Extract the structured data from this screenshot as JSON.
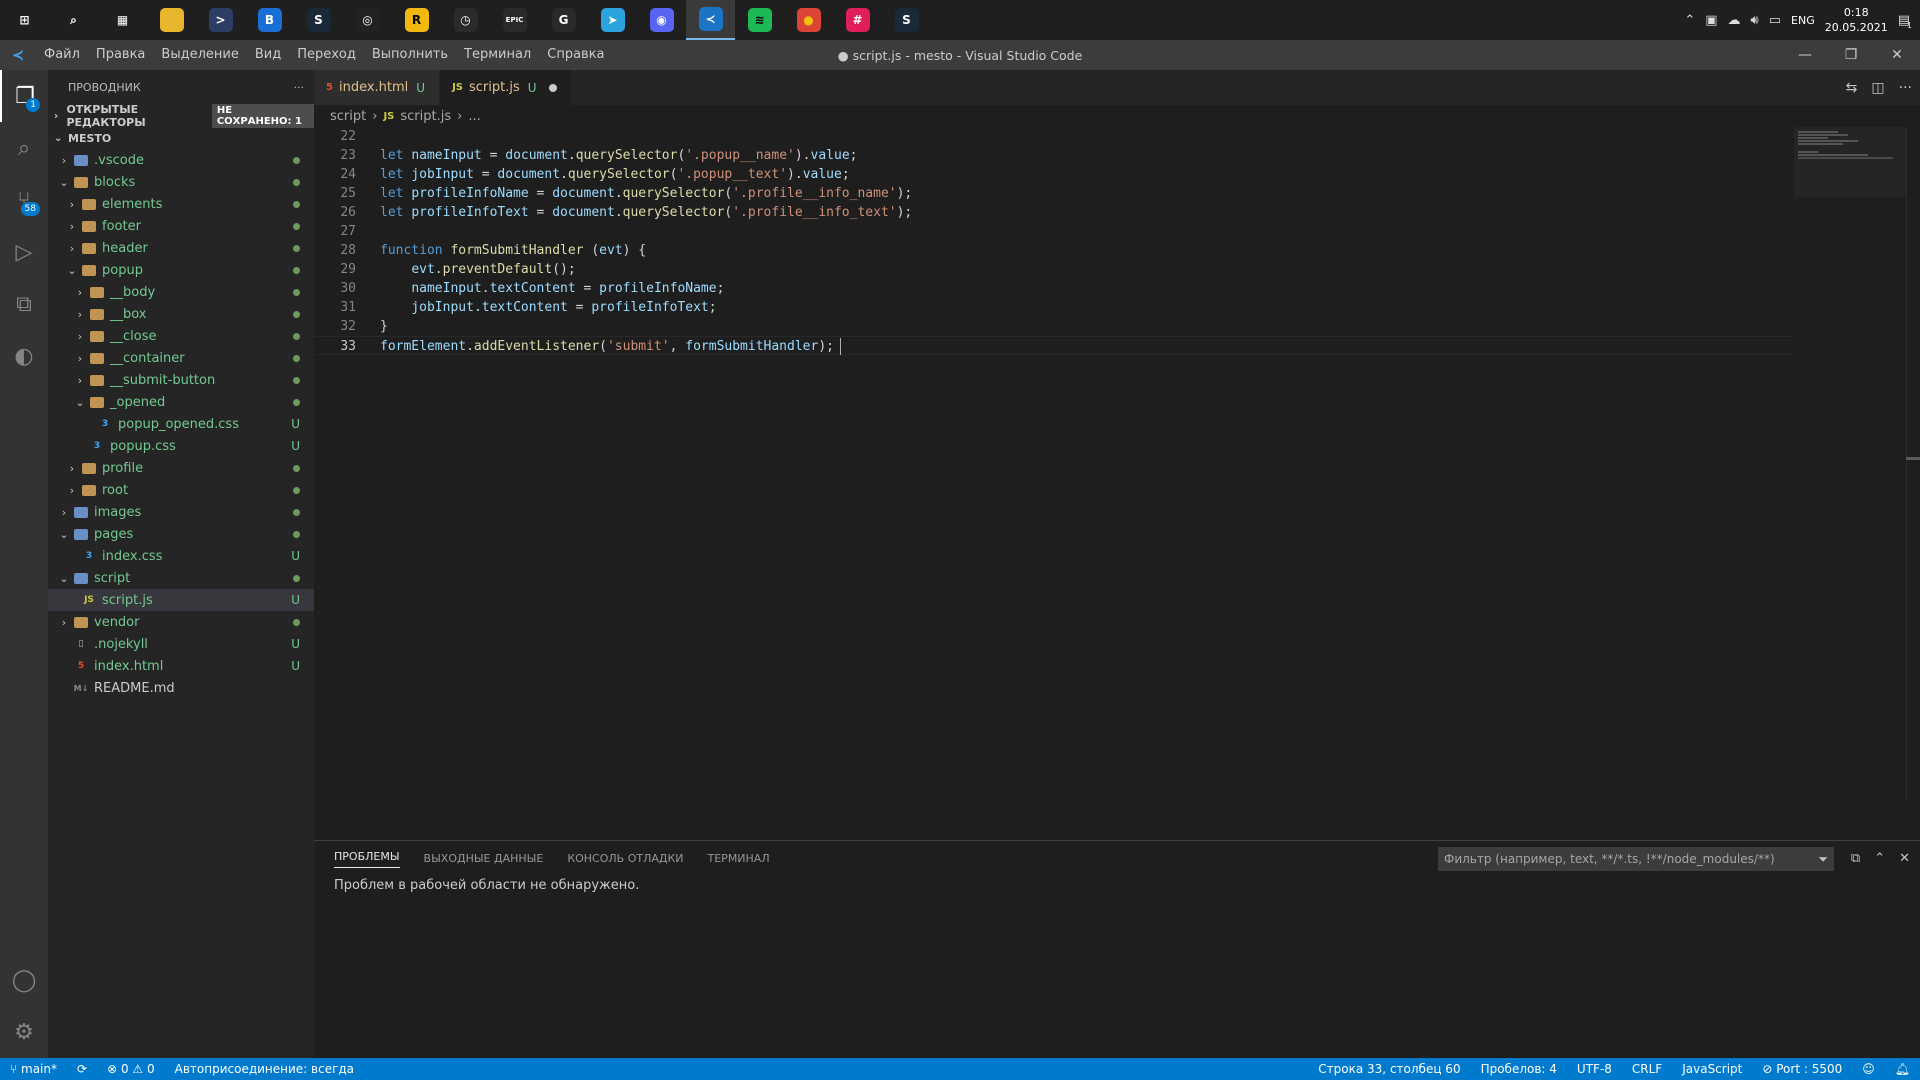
{
  "taskbar": {
    "apps": [
      {
        "name": "windows-start-icon",
        "glyph": "⊞",
        "color": "#1f1f1f",
        "fg": "#ffffff"
      },
      {
        "name": "search-icon",
        "glyph": "⌕",
        "color": "#1f1f1f",
        "fg": "#ffffff"
      },
      {
        "name": "task-view-icon",
        "glyph": "▦",
        "color": "#1f1f1f",
        "fg": "#ffffff"
      },
      {
        "name": "file-explorer-icon",
        "glyph": "",
        "color": "#e8b52c",
        "fg": "#ffffff"
      },
      {
        "name": "terminal-icon",
        "glyph": ">",
        "color": "#2c3e66",
        "fg": "#ffffff"
      },
      {
        "name": "app-blue-icon",
        "glyph": "B",
        "color": "#1a6fd6",
        "fg": "#ffffff"
      },
      {
        "name": "steam-icon",
        "glyph": "S",
        "color": "#1b2838",
        "fg": "#ffffff"
      },
      {
        "name": "obs-icon",
        "glyph": "◎",
        "color": "#222222",
        "fg": "#ffffff"
      },
      {
        "name": "rockstar-icon",
        "glyph": "R",
        "color": "#f2b80d",
        "fg": "#000000"
      },
      {
        "name": "clock-app-icon",
        "glyph": "◷",
        "color": "#2a2a2a",
        "fg": "#ffffff"
      },
      {
        "name": "epic-games-icon",
        "glyph": "EPIC",
        "color": "#2a2a2a",
        "fg": "#ffffff"
      },
      {
        "name": "g-hub-icon",
        "glyph": "G",
        "color": "#2a2a2a",
        "fg": "#ffffff"
      },
      {
        "name": "telegram-icon",
        "glyph": "➤",
        "color": "#2aa3de",
        "fg": "#ffffff"
      },
      {
        "name": "discord-icon",
        "glyph": "◉",
        "color": "#5865f2",
        "fg": "#ffffff"
      },
      {
        "name": "vscode-icon",
        "glyph": "≺",
        "color": "#1b74c5",
        "fg": "#ffffff",
        "active": true
      },
      {
        "name": "spotify-icon",
        "glyph": "≋",
        "color": "#1db954",
        "fg": "#000000"
      },
      {
        "name": "chrome-icon",
        "glyph": "●",
        "color": "#db4437",
        "fg": "#f4c20d"
      },
      {
        "name": "slack-icon",
        "glyph": "#",
        "color": "#e01e5a",
        "fg": "#ffffff"
      },
      {
        "name": "steam-icon-2",
        "glyph": "S",
        "color": "#1b2838",
        "fg": "#ffffff"
      }
    ],
    "tray": {
      "lang": "ENG",
      "time": "0:18",
      "date": "20.05.2021",
      "notifications": "1"
    }
  },
  "titlebar": {
    "menu": [
      "Файл",
      "Правка",
      "Выделение",
      "Вид",
      "Переход",
      "Выполнить",
      "Терминал",
      "Справка"
    ],
    "title": "● script.js - mesto - Visual Studio Code"
  },
  "activitybar": {
    "explorer_badge": "1",
    "scm_badge": "58"
  },
  "sidebar": {
    "title": "ПРОВОДНИК",
    "more": "···",
    "open_editors": "ОТКРЫТЫЕ РЕДАКТОРЫ",
    "unsaved": "НЕ СОХРАНЕНО: 1",
    "project": "MESTO",
    "tree": [
      {
        "label": ".vscode",
        "depth": 0,
        "type": "folder",
        "special": true,
        "chev": "›",
        "status": "dot"
      },
      {
        "label": "blocks",
        "depth": 0,
        "type": "folder",
        "chev": "⌄",
        "status": "dot"
      },
      {
        "label": "elements",
        "depth": 1,
        "type": "folder",
        "chev": "›",
        "status": "dot"
      },
      {
        "label": "footer",
        "depth": 1,
        "type": "folder",
        "chev": "›",
        "status": "dot"
      },
      {
        "label": "header",
        "depth": 1,
        "type": "folder",
        "chev": "›",
        "status": "dot"
      },
      {
        "label": "popup",
        "depth": 1,
        "type": "folder",
        "chev": "⌄",
        "status": "dot"
      },
      {
        "label": "__body",
        "depth": 2,
        "type": "folder",
        "chev": "›",
        "status": "dot"
      },
      {
        "label": "__box",
        "depth": 2,
        "type": "folder",
        "chev": "›",
        "status": "dot"
      },
      {
        "label": "__close",
        "depth": 2,
        "type": "folder",
        "chev": "›",
        "status": "dot"
      },
      {
        "label": "__container",
        "depth": 2,
        "type": "folder",
        "chev": "›",
        "status": "dot"
      },
      {
        "label": "__submit-button",
        "depth": 2,
        "type": "folder",
        "chev": "›",
        "status": "dot"
      },
      {
        "label": "_opened",
        "depth": 2,
        "type": "folder",
        "chev": "⌄",
        "status": "dot"
      },
      {
        "label": "popup_opened.css",
        "depth": 3,
        "type": "css",
        "status": "U"
      },
      {
        "label": "popup.css",
        "depth": 2,
        "type": "css",
        "status": "U"
      },
      {
        "label": "profile",
        "depth": 1,
        "type": "folder",
        "chev": "›",
        "status": "dot"
      },
      {
        "label": "root",
        "depth": 1,
        "type": "folder",
        "chev": "›",
        "status": "dot"
      },
      {
        "label": "images",
        "depth": 0,
        "type": "folder",
        "special": true,
        "chev": "›",
        "status": "dot"
      },
      {
        "label": "pages",
        "depth": 0,
        "type": "folder",
        "special": true,
        "chev": "⌄",
        "status": "dot"
      },
      {
        "label": "index.css",
        "depth": 1,
        "type": "css",
        "status": "U"
      },
      {
        "label": "script",
        "depth": 0,
        "type": "folder",
        "special": true,
        "chev": "⌄",
        "status": "dot"
      },
      {
        "label": "script.js",
        "depth": 1,
        "type": "js",
        "status": "U",
        "selected": true
      },
      {
        "label": "vendor",
        "depth": 0,
        "type": "folder",
        "chev": "›",
        "status": "dot"
      },
      {
        "label": ".nojekyll",
        "depth": 0,
        "type": "file",
        "status": "U"
      },
      {
        "label": "index.html",
        "depth": 0,
        "type": "html",
        "status": "U"
      },
      {
        "label": "README.md",
        "depth": 0,
        "type": "md",
        "status": ""
      }
    ]
  },
  "editor": {
    "tabs": [
      {
        "icon": "5",
        "icon_color": "#e44d26",
        "label": "index.html",
        "status": "U",
        "active": false
      },
      {
        "icon": "JS",
        "icon_color": "#cbcb41",
        "label": "script.js",
        "status": "U",
        "active": true,
        "dirty": true
      }
    ],
    "breadcrumbs": {
      "folder": "script",
      "file_icon": "JS",
      "file": "script.js",
      "tail": "..."
    },
    "lines": [
      {
        "n": "22",
        "tokens": []
      },
      {
        "n": "23",
        "tokens": [
          [
            "kw",
            "let "
          ],
          [
            "var",
            "nameInput"
          ],
          [
            "plain",
            " = "
          ],
          [
            "var",
            "document"
          ],
          [
            "plain",
            "."
          ],
          [
            "fn",
            "querySelector"
          ],
          [
            "plain",
            "("
          ],
          [
            "str",
            "'.popup__name'"
          ],
          [
            "plain",
            ")."
          ],
          [
            "var",
            "value"
          ],
          [
            "plain",
            ";"
          ]
        ]
      },
      {
        "n": "24",
        "tokens": [
          [
            "kw",
            "let "
          ],
          [
            "var",
            "jobInput"
          ],
          [
            "plain",
            " = "
          ],
          [
            "var",
            "document"
          ],
          [
            "plain",
            "."
          ],
          [
            "fn",
            "querySelector"
          ],
          [
            "plain",
            "("
          ],
          [
            "str",
            "'.popup__text'"
          ],
          [
            "plain",
            ")."
          ],
          [
            "var",
            "value"
          ],
          [
            "plain",
            ";"
          ]
        ]
      },
      {
        "n": "25",
        "tokens": [
          [
            "kw",
            "let "
          ],
          [
            "var",
            "profileInfoName"
          ],
          [
            "plain",
            " = "
          ],
          [
            "var",
            "document"
          ],
          [
            "plain",
            "."
          ],
          [
            "fn",
            "querySelector"
          ],
          [
            "plain",
            "("
          ],
          [
            "str",
            "'.profile__info_name'"
          ],
          [
            "plain",
            ");"
          ]
        ]
      },
      {
        "n": "26",
        "tokens": [
          [
            "kw",
            "let "
          ],
          [
            "var",
            "profileInfoText"
          ],
          [
            "plain",
            " = "
          ],
          [
            "var",
            "document"
          ],
          [
            "plain",
            "."
          ],
          [
            "fn",
            "querySelector"
          ],
          [
            "plain",
            "("
          ],
          [
            "str",
            "'.profile__info_text'"
          ],
          [
            "plain",
            ");"
          ]
        ]
      },
      {
        "n": "27",
        "tokens": []
      },
      {
        "n": "28",
        "tokens": [
          [
            "kw",
            "function "
          ],
          [
            "fn",
            "formSubmitHandler"
          ],
          [
            "plain",
            " ("
          ],
          [
            "var",
            "evt"
          ],
          [
            "plain",
            ") {"
          ]
        ]
      },
      {
        "n": "29",
        "tokens": [
          [
            "plain",
            "    "
          ],
          [
            "var",
            "evt"
          ],
          [
            "plain",
            "."
          ],
          [
            "fn",
            "preventDefault"
          ],
          [
            "plain",
            "();"
          ]
        ]
      },
      {
        "n": "30",
        "tokens": [
          [
            "plain",
            "    "
          ],
          [
            "var",
            "nameInput"
          ],
          [
            "plain",
            "."
          ],
          [
            "var",
            "textContent"
          ],
          [
            "plain",
            " = "
          ],
          [
            "var",
            "profileInfoName"
          ],
          [
            "plain",
            ";"
          ]
        ]
      },
      {
        "n": "31",
        "tokens": [
          [
            "plain",
            "    "
          ],
          [
            "var",
            "jobInput"
          ],
          [
            "plain",
            "."
          ],
          [
            "var",
            "textContent"
          ],
          [
            "plain",
            " = "
          ],
          [
            "var",
            "profileInfoText"
          ],
          [
            "plain",
            ";"
          ]
        ]
      },
      {
        "n": "32",
        "tokens": [
          [
            "plain",
            "}"
          ]
        ]
      },
      {
        "n": "33",
        "tokens": [
          [
            "var",
            "formElement"
          ],
          [
            "plain",
            "."
          ],
          [
            "fn",
            "addEventListener"
          ],
          [
            "plain",
            "("
          ],
          [
            "str",
            "'submit'"
          ],
          [
            "plain",
            ", "
          ],
          [
            "var",
            "formSubmitHandler"
          ],
          [
            "plain",
            ");"
          ]
        ],
        "current": true
      }
    ]
  },
  "panel": {
    "tabs": [
      "ПРОБЛЕМЫ",
      "ВЫХОДНЫЕ ДАННЫЕ",
      "КОНСОЛЬ ОТЛАДКИ",
      "ТЕРМИНАЛ"
    ],
    "filter_placeholder": "Фильтр (например, text, **/*.ts, !**/node_modules/**)",
    "message": "Проблем в рабочей области не обнаружено."
  },
  "statusbar": {
    "branch": "main*",
    "sync": "⟳",
    "errors": "0",
    "warnings": "0",
    "autoconnect": "Автоприсоединение: всегда",
    "position": "Строка 33, столбец 60",
    "spaces": "Пробелов: 4",
    "encoding": "UTF-8",
    "eol": "CRLF",
    "language": "JavaScript",
    "port": "Port : 5500"
  }
}
